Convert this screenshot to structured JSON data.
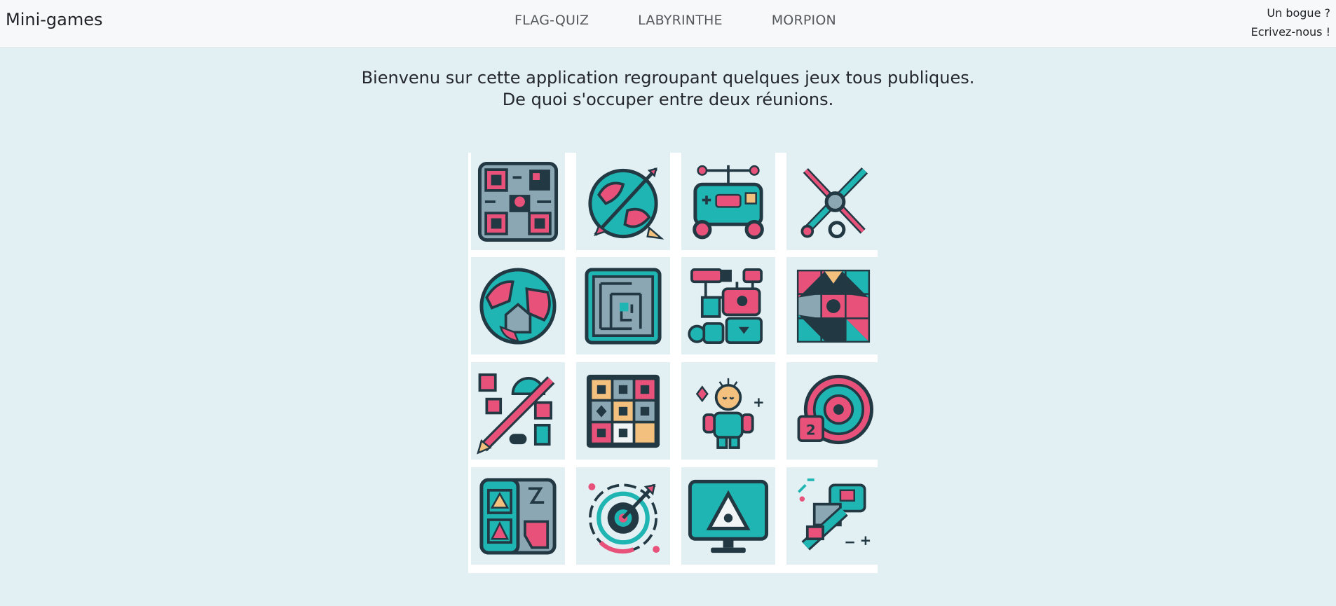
{
  "header": {
    "brand": "Mini-games",
    "nav": [
      {
        "label": "FLAG-QUIZ"
      },
      {
        "label": "LABYRINTHE"
      },
      {
        "label": "MORPION"
      }
    ],
    "bug_line1": "Un bogue ?",
    "bug_line2": "Ecrivez-nous !"
  },
  "welcome": {
    "line1": "Bienvenu sur cette application regroupant quelques jeux tous publiques.",
    "line2": "De quoi s'occuper entre deux réunions."
  },
  "tiles": [
    {
      "icon": "qr-code-puzzle-icon"
    },
    {
      "icon": "globe-dart-icon"
    },
    {
      "icon": "robot-console-icon"
    },
    {
      "icon": "crossed-tools-icon"
    },
    {
      "icon": "world-puzzle-icon"
    },
    {
      "icon": "maze-icon"
    },
    {
      "icon": "robot-flowchart-icon"
    },
    {
      "icon": "geometric-puzzle-icon"
    },
    {
      "icon": "pencil-blocks-icon"
    },
    {
      "icon": "memory-grid-icon"
    },
    {
      "icon": "character-icon"
    },
    {
      "icon": "spiral-badge-icon"
    },
    {
      "icon": "split-panel-icon"
    },
    {
      "icon": "target-arrow-icon"
    },
    {
      "icon": "monitor-triangle-icon"
    },
    {
      "icon": "blocks-arrow-icon"
    }
  ],
  "colors": {
    "background": "#e2f0f3",
    "teal": "#1fb5b3",
    "pink": "#e8517a",
    "navy": "#223843",
    "steel": "#8ba7b4",
    "peach": "#f4c07e"
  }
}
